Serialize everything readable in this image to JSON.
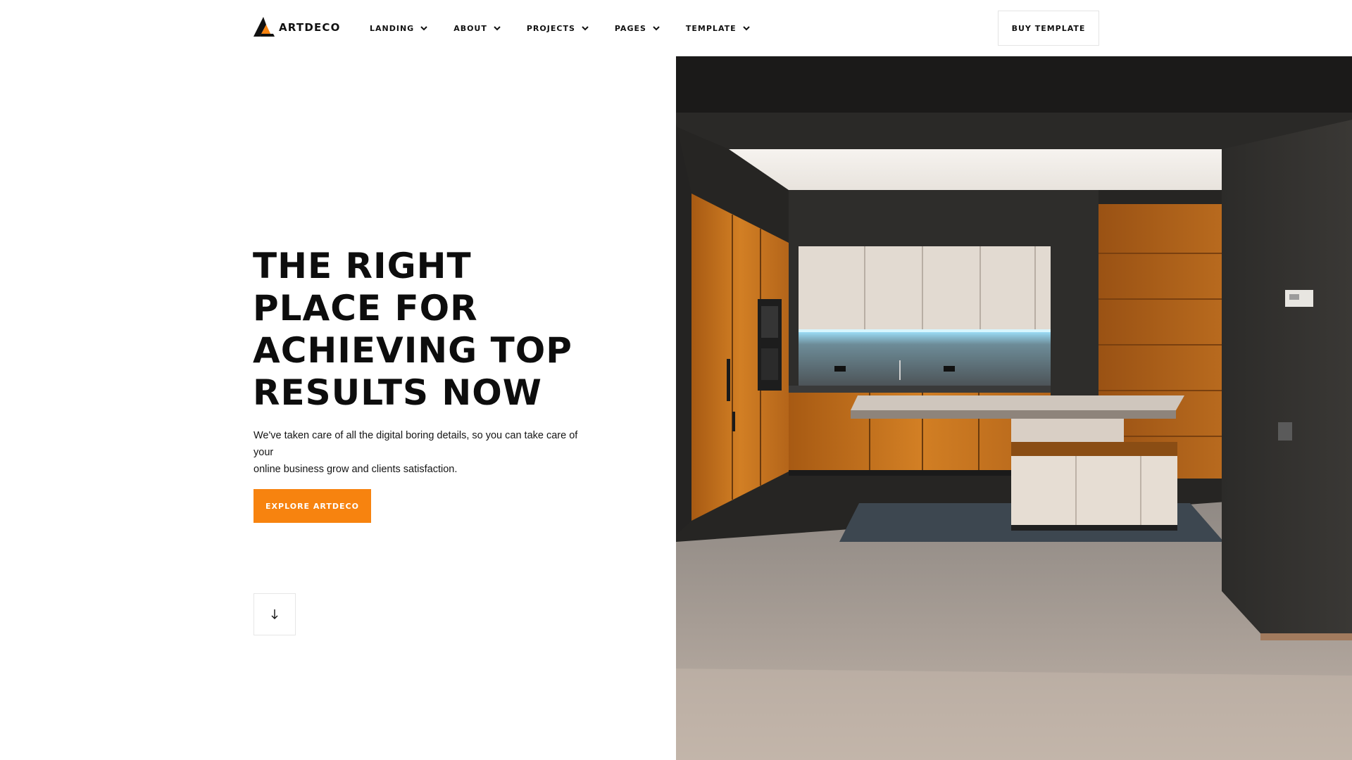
{
  "brand": {
    "name": "ARTDECO",
    "accent_color": "#f7830f"
  },
  "nav": {
    "items": [
      {
        "label": "LANDING",
        "icon": "chevron-down-icon"
      },
      {
        "label": "ABOUT",
        "icon": "chevron-down-icon"
      },
      {
        "label": "PROJECTS",
        "icon": "chevron-down-icon"
      },
      {
        "label": "PAGES",
        "icon": "chevron-down-icon"
      },
      {
        "label": "TEMPLATE",
        "icon": "chevron-down-icon"
      }
    ],
    "buy_label": "BUY TEMPLATE"
  },
  "hero": {
    "title_lines": [
      "THE RIGHT",
      "PLACE FOR",
      "ACHIEVING TOP",
      "RESULTS NOW"
    ],
    "subtitle_lines": [
      "We've taken care of all the digital boring details, so you can take care of your",
      "online business grow and clients satisfaction."
    ],
    "cta_label": "EXPLORE ARTDECO",
    "scroll_icon": "arrow-down-icon",
    "image": "modern-kitchen-photo"
  }
}
